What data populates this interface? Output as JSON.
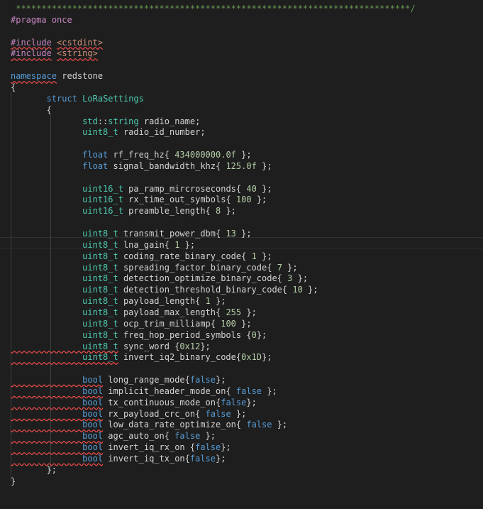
{
  "editor": {
    "colors": {
      "background": "#1e1e1e",
      "text": "#d4d4d4",
      "keyword": "#569cd6",
      "type": "#4ec9b0",
      "number": "#b5cea8",
      "comment": "#6a9955",
      "preprocessor": "#c586c0",
      "string": "#ce9178",
      "error_squiggle": "#f14c4c"
    },
    "lines": [
      {
        "tokens": [
          {
            "t": " *****************************************************************************/",
            "c": "comment"
          }
        ]
      },
      {
        "tokens": [
          {
            "t": "#pragma",
            "c": "pre"
          },
          {
            "t": " "
          },
          {
            "t": "once",
            "c": "pre"
          }
        ]
      },
      {
        "tokens": []
      },
      {
        "tokens": [
          {
            "t": "#include",
            "c": "pre",
            "sq": true
          },
          {
            "t": " "
          },
          {
            "t": "<cstdint>",
            "c": "str",
            "sq": true
          }
        ]
      },
      {
        "tokens": [
          {
            "t": "#include",
            "c": "pre",
            "sq": true
          },
          {
            "t": " "
          },
          {
            "t": "<string>",
            "c": "str",
            "sq": true
          }
        ]
      },
      {
        "tokens": []
      },
      {
        "tokens": [
          {
            "t": "namespace",
            "c": "kw",
            "sq": true
          },
          {
            "t": " redstone"
          }
        ]
      },
      {
        "tokens": [
          {
            "t": "{"
          }
        ]
      },
      {
        "tokens": [
          {
            "t": "\t"
          },
          {
            "t": "struct",
            "c": "kw"
          },
          {
            "t": " "
          },
          {
            "t": "LoRaSettings",
            "c": "type"
          }
        ]
      },
      {
        "tokens": [
          {
            "t": "\t{"
          }
        ]
      },
      {
        "tokens": [
          {
            "t": "\t\tstd",
            "c": "type"
          },
          {
            "t": "::"
          },
          {
            "t": "string",
            "c": "type"
          },
          {
            "t": " radio_name;"
          }
        ]
      },
      {
        "tokens": [
          {
            "t": "\t\tuint8_t",
            "c": "type"
          },
          {
            "t": " radio_id_number;"
          }
        ]
      },
      {
        "tokens": []
      },
      {
        "tokens": [
          {
            "t": "\t\tfloat",
            "c": "kw"
          },
          {
            "t": " rf_freq_hz{ "
          },
          {
            "t": "434000000.0f",
            "c": "num"
          },
          {
            "t": " };"
          }
        ]
      },
      {
        "tokens": [
          {
            "t": "\t\tfloat",
            "c": "kw"
          },
          {
            "t": " signal_bandwidth_khz{ "
          },
          {
            "t": "125.0f",
            "c": "num"
          },
          {
            "t": " };"
          }
        ]
      },
      {
        "tokens": []
      },
      {
        "tokens": [
          {
            "t": "\t\tuint16_t",
            "c": "type"
          },
          {
            "t": " pa_ramp_mircroseconds{ "
          },
          {
            "t": "40",
            "c": "num"
          },
          {
            "t": " };"
          }
        ]
      },
      {
        "tokens": [
          {
            "t": "\t\tuint16_t",
            "c": "type"
          },
          {
            "t": " rx_time_out_symbols{ "
          },
          {
            "t": "100",
            "c": "num"
          },
          {
            "t": " };"
          }
        ]
      },
      {
        "tokens": [
          {
            "t": "\t\tuint16_t",
            "c": "type"
          },
          {
            "t": " preamble_length{ "
          },
          {
            "t": "8",
            "c": "num"
          },
          {
            "t": " };"
          }
        ]
      },
      {
        "tokens": []
      },
      {
        "tokens": [
          {
            "t": "\t\tuint8_t",
            "c": "type"
          },
          {
            "t": " transmit_power_dbm{ "
          },
          {
            "t": "13",
            "c": "num"
          },
          {
            "t": " };"
          }
        ]
      },
      {
        "tokens": [
          {
            "t": "\t\tuint8_t",
            "c": "type"
          },
          {
            "t": " lna_gain{ "
          },
          {
            "t": "1",
            "c": "num"
          },
          {
            "t": " };"
          }
        ],
        "current": true
      },
      {
        "tokens": [
          {
            "t": "\t\tuint8_t",
            "c": "type"
          },
          {
            "t": " coding_rate_binary_code{ "
          },
          {
            "t": "1",
            "c": "num"
          },
          {
            "t": " };"
          }
        ]
      },
      {
        "tokens": [
          {
            "t": "\t\tuint8_t",
            "c": "type"
          },
          {
            "t": " spreading_factor_binary_code{ "
          },
          {
            "t": "7",
            "c": "num"
          },
          {
            "t": " };"
          }
        ]
      },
      {
        "tokens": [
          {
            "t": "\t\tuint8_t",
            "c": "type"
          },
          {
            "t": " detection_optimize_binary_code{ "
          },
          {
            "t": "3",
            "c": "num"
          },
          {
            "t": " };"
          }
        ]
      },
      {
        "tokens": [
          {
            "t": "\t\tuint8_t",
            "c": "type"
          },
          {
            "t": " detection_threshold_binary_code{ "
          },
          {
            "t": "10",
            "c": "num"
          },
          {
            "t": " };"
          }
        ]
      },
      {
        "tokens": [
          {
            "t": "\t\tuint8_t",
            "c": "type"
          },
          {
            "t": " payload_length{ "
          },
          {
            "t": "1",
            "c": "num"
          },
          {
            "t": " };"
          }
        ]
      },
      {
        "tokens": [
          {
            "t": "\t\tuint8_t",
            "c": "type"
          },
          {
            "t": " payload_max_length{ "
          },
          {
            "t": "255",
            "c": "num"
          },
          {
            "t": " };"
          }
        ]
      },
      {
        "tokens": [
          {
            "t": "\t\tuint8_t",
            "c": "type"
          },
          {
            "t": " ocp_trim_milliamp{ "
          },
          {
            "t": "100",
            "c": "num"
          },
          {
            "t": " };"
          }
        ]
      },
      {
        "tokens": [
          {
            "t": "\t\tuint8_t",
            "c": "type"
          },
          {
            "t": " freq_hop_period_symbols {"
          },
          {
            "t": "0",
            "c": "num"
          },
          {
            "t": "};"
          }
        ]
      },
      {
        "tokens": [
          {
            "t": "\t\tuint8_t",
            "c": "type",
            "sq": true
          },
          {
            "t": " sync_word {"
          },
          {
            "t": "0x12",
            "c": "num"
          },
          {
            "t": "};"
          }
        ]
      },
      {
        "tokens": [
          {
            "t": "\t\tuint8_t",
            "c": "type",
            "sq": true
          },
          {
            "t": " invert_iq2_binary_code{"
          },
          {
            "t": "0x1D",
            "c": "num"
          },
          {
            "t": "};"
          }
        ]
      },
      {
        "tokens": []
      },
      {
        "tokens": [
          {
            "t": "\t\tbool",
            "c": "kw",
            "sq": true
          },
          {
            "t": " long_range_mode{"
          },
          {
            "t": "false",
            "c": "kw"
          },
          {
            "t": "};"
          }
        ]
      },
      {
        "tokens": [
          {
            "t": "\t\tbool",
            "c": "kw",
            "sq": true
          },
          {
            "t": " implicit_header_mode_on{ "
          },
          {
            "t": "false",
            "c": "kw"
          },
          {
            "t": " };"
          }
        ]
      },
      {
        "tokens": [
          {
            "t": "\t\tbool",
            "c": "kw",
            "sq": true
          },
          {
            "t": " tx_continuous_mode_on{"
          },
          {
            "t": "false",
            "c": "kw"
          },
          {
            "t": "};"
          }
        ]
      },
      {
        "tokens": [
          {
            "t": "\t\tbool",
            "c": "kw",
            "sq": true
          },
          {
            "t": " rx_payload_crc_on{ "
          },
          {
            "t": "false",
            "c": "kw"
          },
          {
            "t": " };"
          }
        ]
      },
      {
        "tokens": [
          {
            "t": "\t\tbool",
            "c": "kw",
            "sq": true
          },
          {
            "t": " low_data_rate_optimize_on{ "
          },
          {
            "t": "false",
            "c": "kw"
          },
          {
            "t": " };"
          }
        ]
      },
      {
        "tokens": [
          {
            "t": "\t\tbool",
            "c": "kw",
            "sq": true
          },
          {
            "t": " agc_auto_on{ "
          },
          {
            "t": "false",
            "c": "kw"
          },
          {
            "t": " };"
          }
        ]
      },
      {
        "tokens": [
          {
            "t": "\t\tbool",
            "c": "kw",
            "sq": true
          },
          {
            "t": " invert_iq_rx_on {"
          },
          {
            "t": "false",
            "c": "kw"
          },
          {
            "t": "};"
          }
        ]
      },
      {
        "tokens": [
          {
            "t": "\t\tbool",
            "c": "kw",
            "sq": true
          },
          {
            "t": " invert_iq_tx_on{"
          },
          {
            "t": "false",
            "c": "kw"
          },
          {
            "t": "};"
          }
        ]
      },
      {
        "tokens": [
          {
            "t": "\t};"
          }
        ]
      },
      {
        "tokens": [
          {
            "t": "}"
          }
        ]
      }
    ]
  }
}
